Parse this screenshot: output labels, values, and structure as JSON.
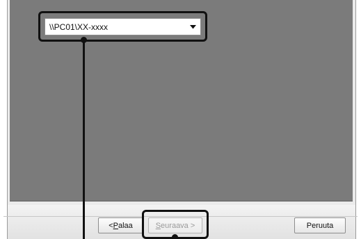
{
  "dialog": {
    "share_select": {
      "value": "\\\\PC01\\XX-xxxx",
      "icon": "chevron-down-icon"
    },
    "buttons": {
      "back": {
        "prefix": "< ",
        "accel": "P",
        "rest": "alaa"
      },
      "next": {
        "accel": "S",
        "rest": "euraava >",
        "state": "disabled"
      },
      "cancel": "Peruuta"
    }
  }
}
